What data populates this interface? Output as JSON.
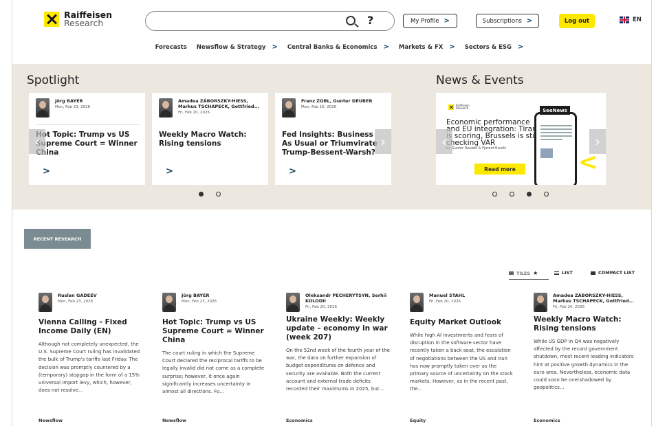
{
  "header": {
    "brand": "Raiffeisen",
    "brand_sub": "Research",
    "search_placeholder": "",
    "help": "?",
    "my_profile": "My Profile",
    "subscriptions": "Subscriptions",
    "logout": "Log out",
    "lang": "EN"
  },
  "nav": [
    {
      "label": "Forecasts",
      "chevron": false
    },
    {
      "label": "Newsflow & Strategy",
      "chevron": true
    },
    {
      "label": "Central Banks & Economics",
      "chevron": true
    },
    {
      "label": "Markets & FX",
      "chevron": true
    },
    {
      "label": "Sectors & ESG",
      "chevron": true
    }
  ],
  "spotlight": {
    "title": "Spotlight",
    "cards": [
      {
        "author": "Jörg BAYER",
        "author2": "",
        "date": "Mon, Feb 23, 2026",
        "title": "Hot Topic: Trump vs US Supreme Court = Winner China"
      },
      {
        "author": "Amadea ZÁBORSZKY-HIESS,",
        "author2": "Markus TSCHAPECK, Gottfried...",
        "date": "Fri, Feb 20, 2026",
        "title": "Weekly Macro Watch: Rising tensions"
      },
      {
        "author": "Franz ZOBL, Gunter DEUBER",
        "author2": "",
        "date": "Mon, Feb 16, 2026",
        "title": "Fed Insights: Business As Usual or Triumvirate Trump-Bessent-Warsh?"
      }
    ]
  },
  "news": {
    "title": "News & Events",
    "logo_brand": "Raiffeisen",
    "logo_sub": "Research",
    "headline": "Economic performance and EU integration: Tirana is scoring, Brussels is still checking VAR",
    "byline": "by Gunter Deuber & Fjorent Rrushi",
    "read_more": "Read more",
    "partner": "SeeNews"
  },
  "recent": {
    "button": "RECENT RESEARCH",
    "views": {
      "tiles": "TILES",
      "list": "LIST",
      "compact": "COMPACT LIST"
    },
    "cards": [
      {
        "author": "Ruslan GADEEV",
        "author2": "",
        "date": "Mon, Feb 23, 2026",
        "title": "Vienna Calling - Fixed Income Daily (EN)",
        "text": "Although not completely unexpected, the U.S. Supreme Court ruling has invalidated the bulk of Trump's tariffs last Friday. The decision was promptly countered by a (temporary) stopgap in the form of a 15% universal import levy, which, however, does not resolve...",
        "tag": "Newsflow"
      },
      {
        "author": "Jörg BAYER",
        "author2": "",
        "date": "Mon, Feb 23, 2026",
        "title": "Hot Topic: Trump vs US Supreme Court = Winner China",
        "text": "The court ruling in which the Supreme Court declared the reciprocal tariffs to be legally invalid did not come as a complete surprise; however, it once again significantly increases uncertainty in almost all directions. Fo...",
        "tag": "Newsflow"
      },
      {
        "author": "Oleksandr PECHERYTSYN, Serhii",
        "author2": "KOLODII",
        "date": "Fri, Feb 20, 2026",
        "title": "Ukraine Weekly: Weekly update – economy in war (week 207)",
        "text": "On the 52nd week of the fourth year of the war, the data on further expansion of budget expenditures on defence and security are available. Both the current account and external trade deficits recorded their maximums in 2025, but...",
        "tag": "Economics"
      },
      {
        "author": "Manuel STAHL",
        "author2": "",
        "date": "Fri, Feb 20, 2026",
        "title": "Equity Market Outlook",
        "text": "While high AI investments and fears of disruption in the software sector have recently taken a back seat, the escalation of negotiations between the US and Iran has now promptly taken over as the primary source of uncertainty on the stock markets. However, as in the recent past, the...",
        "tag": "Equity"
      },
      {
        "author": "Amadea ZÁBORSZKY-HIESS,",
        "author2": "Markus TSCHAPECK, Gottfried...",
        "date": "Fri, Feb 20, 2026",
        "title": "Weekly Macro Watch: Rising tensions",
        "text": "While US GDP in Q4 was negatively affected by the record government shutdown, most recent leading indicators hint at positive growth dynamics in the euro area. Nevertheless, economic data could soon be overshadowed by geopolitics...",
        "tag": "Economics"
      }
    ]
  },
  "colors": {
    "accent": "#fde800",
    "band": "#ece7df",
    "button": "#7a8b91",
    "chevron": "#0c3b57"
  }
}
